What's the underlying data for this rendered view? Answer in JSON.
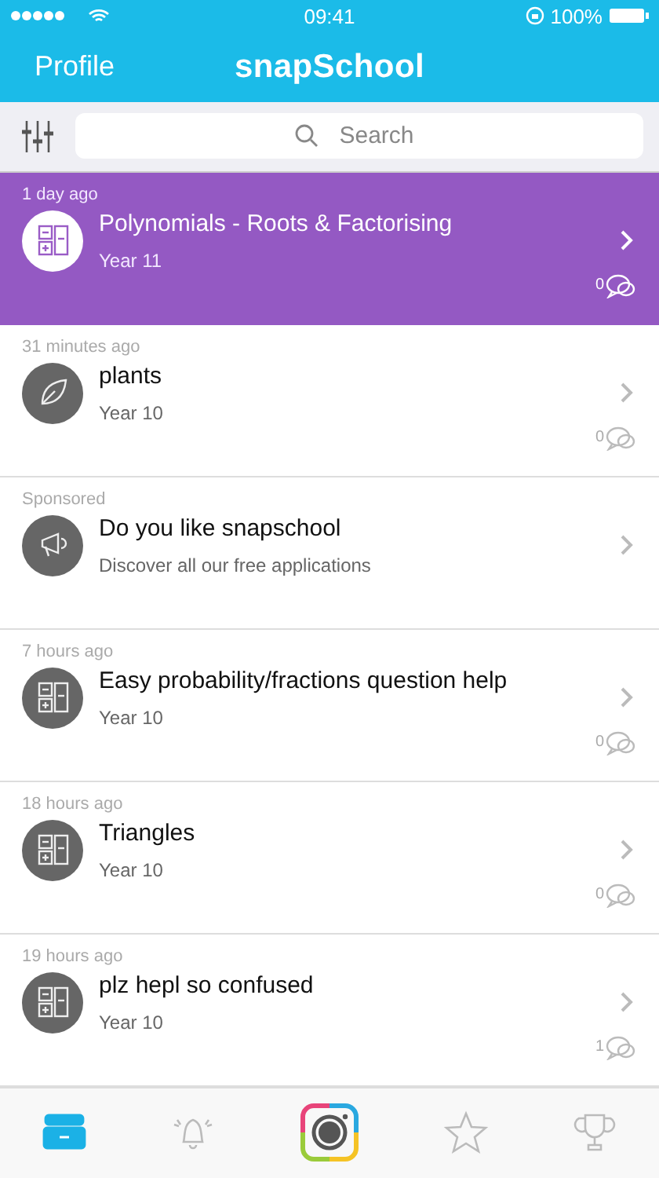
{
  "status_bar": {
    "time": "09:41",
    "battery": "100%"
  },
  "nav": {
    "left": "Profile",
    "title": "snapSchool"
  },
  "search": {
    "placeholder": "Search"
  },
  "posts": [
    {
      "kind": "maths",
      "when": "1 day ago",
      "title": "Polynomials - Roots & Factorising",
      "subtitle": "Year 11",
      "comments": "0",
      "selected": true
    },
    {
      "kind": "biology",
      "when": "31 minutes ago",
      "title": "plants",
      "subtitle": "Year 10",
      "comments": "0",
      "selected": false
    },
    {
      "kind": "sponsored",
      "when": "Sponsored",
      "title": "Do you like snapschool",
      "subtitle": "Discover all our free applications",
      "selected": false
    },
    {
      "kind": "maths",
      "when": "7 hours ago",
      "title": "Easy probability/fractions question help",
      "subtitle": "Year 10",
      "comments": "0",
      "selected": false
    },
    {
      "kind": "maths",
      "when": "18 hours ago",
      "title": "Triangles",
      "subtitle": "Year 10",
      "comments": "0",
      "selected": false
    },
    {
      "kind": "maths",
      "when": "19 hours ago",
      "title": "plz hepl so confused",
      "subtitle": "Year 10",
      "comments": "1",
      "selected": false
    }
  ],
  "tabs": [
    {
      "selected": true
    },
    {
      "selected": false
    },
    {
      "selected": false
    },
    {
      "selected": false
    },
    {
      "selected": false
    }
  ]
}
